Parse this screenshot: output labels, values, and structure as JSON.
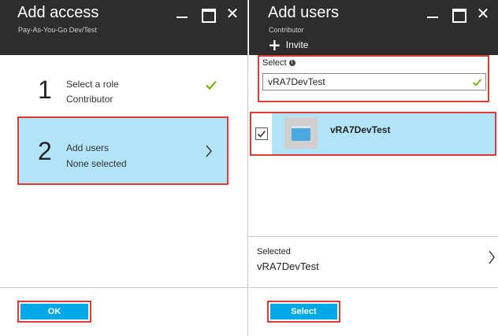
{
  "left_blade": {
    "title": "Add access",
    "subtitle": "Pay-As-You-Go Dev/Test",
    "steps": [
      {
        "number": "1",
        "line1": "Select a role",
        "line2": "Contributor"
      },
      {
        "number": "2",
        "line1": "Add users",
        "line2": "None selected"
      }
    ],
    "ok_label": "OK"
  },
  "right_blade": {
    "title": "Add users",
    "subtitle": "Contributor",
    "invite_label": "Invite",
    "select_label": "Select",
    "select_value": "vRA7DevTest",
    "results": [
      {
        "name": "vRA7DevTest"
      }
    ],
    "selected_label": "Selected",
    "selected_value": "vRA7DevTest",
    "select_button_label": "Select"
  },
  "colors": {
    "header_bg": "#2d2d2d",
    "highlight_bg": "#b1e4f6",
    "accent_button": "#00a8e8",
    "callout_red": "#e03b32",
    "check_green": "#6bb700"
  }
}
